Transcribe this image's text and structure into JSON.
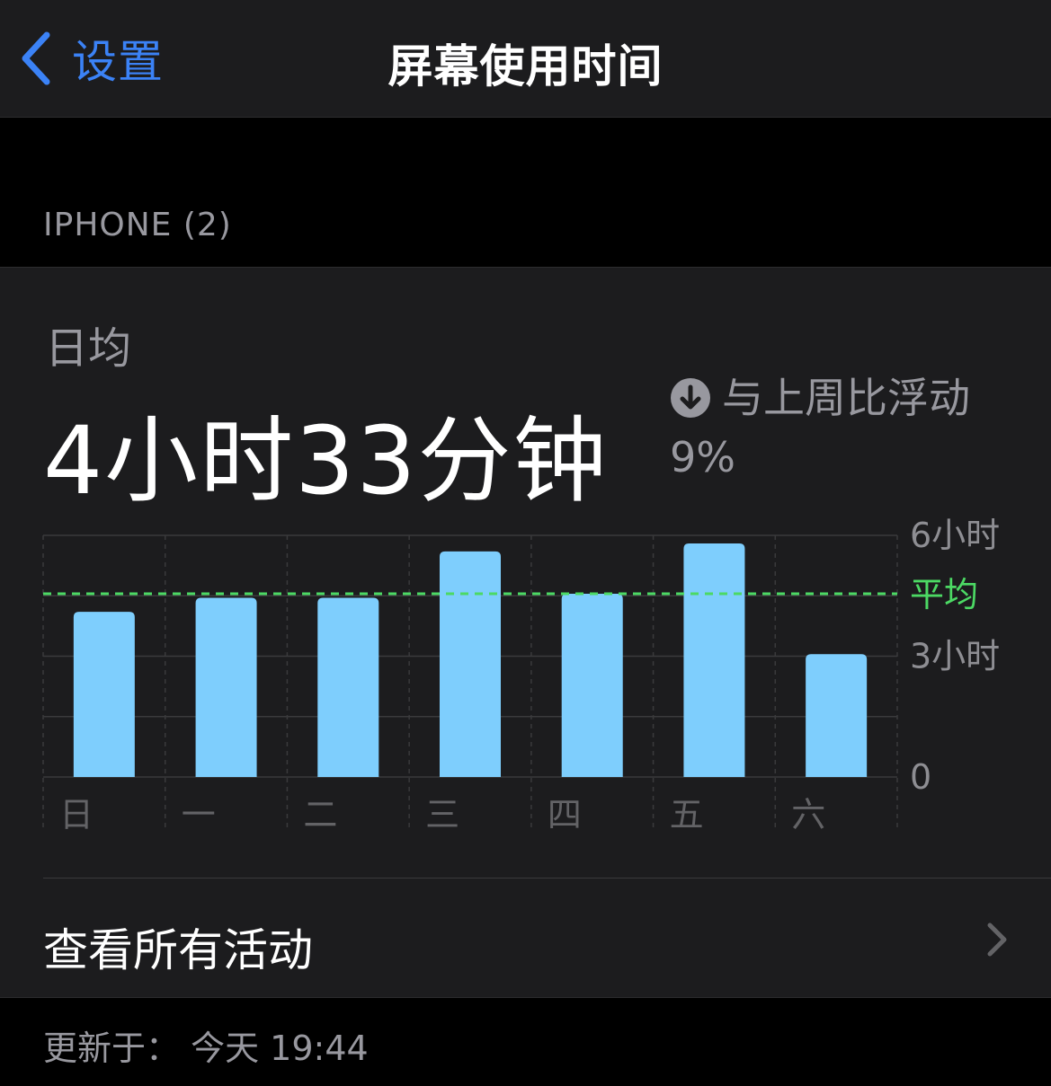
{
  "navbar": {
    "back_label": "设置",
    "title": "屏幕使用时间"
  },
  "section_header": "IPHONE (2)",
  "summary": {
    "avg_label": "日均",
    "avg_value": "4小时33分钟",
    "compare_text": "与上周比浮动",
    "compare_percent": "9%",
    "compare_icon": "arrow-down-circle-icon"
  },
  "chart_data": {
    "type": "bar",
    "categories": [
      "日",
      "一",
      "二",
      "三",
      "四",
      "五",
      "六"
    ],
    "values": [
      4.1,
      4.45,
      4.45,
      5.6,
      4.55,
      5.8,
      3.05
    ],
    "y_tick_labels": [
      "6小时",
      "3小时",
      "0"
    ],
    "ylim": [
      0,
      6
    ],
    "average_label": "平均",
    "average_value": 4.55,
    "bar_color": "#7ecefd",
    "average_color": "#4cd964",
    "grid": true
  },
  "activity": {
    "label": "查看所有活动"
  },
  "footer": {
    "updated": "更新于： 今天 19:44"
  },
  "colors": {
    "accent": "#3b82f6",
    "background": "#000000",
    "card": "#1c1c1e",
    "secondary_text": "#98989f"
  }
}
